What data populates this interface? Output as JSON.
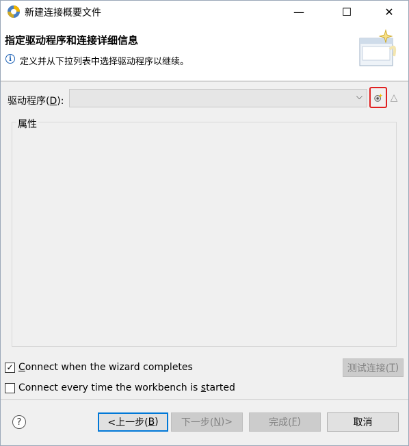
{
  "window": {
    "title": "新建连接概要文件",
    "icon": "eclipse-logo-icon",
    "controls": {
      "minimize": "—",
      "maximize": "☐",
      "close": "✕"
    }
  },
  "header": {
    "title": "指定驱动程序和连接详细信息",
    "description": "定义并从下拉列表中选择驱动程序以继续。",
    "info_icon_glyph": "i",
    "banner_icon": "wizard-banner-icon"
  },
  "driver": {
    "label_prefix": "驱动程序(",
    "label_mnemonic": "D",
    "label_suffix": "):",
    "selected_value": "",
    "dropdown_glyph": "⌵",
    "new_driver_icon": "new-driver-definition-icon",
    "edit_driver_glyph": "△"
  },
  "properties": {
    "group_label": "属性"
  },
  "options": {
    "connect_on_finish": {
      "mnemonic": "C",
      "rest": "onnect when the wizard completes",
      "checked": true,
      "check_glyph": "✓"
    },
    "connect_every_time": {
      "before": "Connect every time the workbench is ",
      "mnemonic": "s",
      "after": "tarted",
      "checked": false,
      "check_glyph": ""
    }
  },
  "test_connection": {
    "label_prefix": "测试连接(",
    "mnemonic": "T",
    "label_suffix": ")"
  },
  "footer": {
    "help_glyph": "?",
    "back": {
      "prefix": "<上一步(",
      "mnemonic": "B",
      "suffix": ")"
    },
    "next": {
      "prefix": "下一步(",
      "mnemonic": "N",
      "suffix": ")>"
    },
    "finish": {
      "prefix": "完成(",
      "mnemonic": "F",
      "suffix": ")"
    },
    "cancel": "取消"
  },
  "colors": {
    "highlight_red": "#e02020",
    "focus_blue": "#0078d7",
    "disabled_text": "#838383",
    "dialog_bg": "#f0f0f0"
  }
}
